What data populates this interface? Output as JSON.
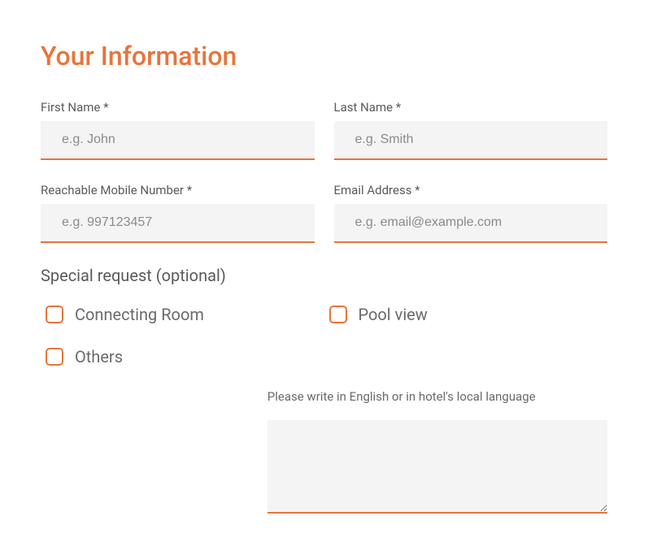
{
  "title": "Your Information",
  "fields": {
    "first_name": {
      "label": "First Name *",
      "placeholder": "e.g. John"
    },
    "last_name": {
      "label": "Last Name *",
      "placeholder": "e.g. Smith"
    },
    "mobile": {
      "label": "Reachable Mobile Number *",
      "placeholder": "e.g. 997123457"
    },
    "email": {
      "label": "Email Address *",
      "placeholder": "e.g. email@example.com"
    }
  },
  "special_request_heading": "Special request (optional)",
  "special_requests": {
    "connecting_room": "Connecting Room",
    "pool_view": "Pool view",
    "others": "Others"
  },
  "note_label": "Please write in English or in hotel's local language"
}
